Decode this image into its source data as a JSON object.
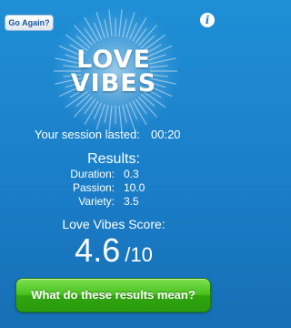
{
  "header": {
    "go_again_label": "Go Again?",
    "info_icon": "info-icon"
  },
  "logo": {
    "line1": "LOVE",
    "line2": "VIBES"
  },
  "session": {
    "label": "Your session lasted:",
    "duration": "00:20"
  },
  "results": {
    "title": "Results:",
    "items": [
      {
        "label": "Duration:",
        "value": "0.3"
      },
      {
        "label": "Passion:",
        "value": "10.0"
      },
      {
        "label": "Variety:",
        "value": "3.5"
      }
    ]
  },
  "score": {
    "label": "Love Vibes Score:",
    "value": "4.6",
    "out_of": "/10"
  },
  "cta": {
    "label": "What do these results mean?"
  },
  "colors": {
    "background": "#1a7ec8",
    "button_green": "#47c21f",
    "text": "#ffffff"
  }
}
